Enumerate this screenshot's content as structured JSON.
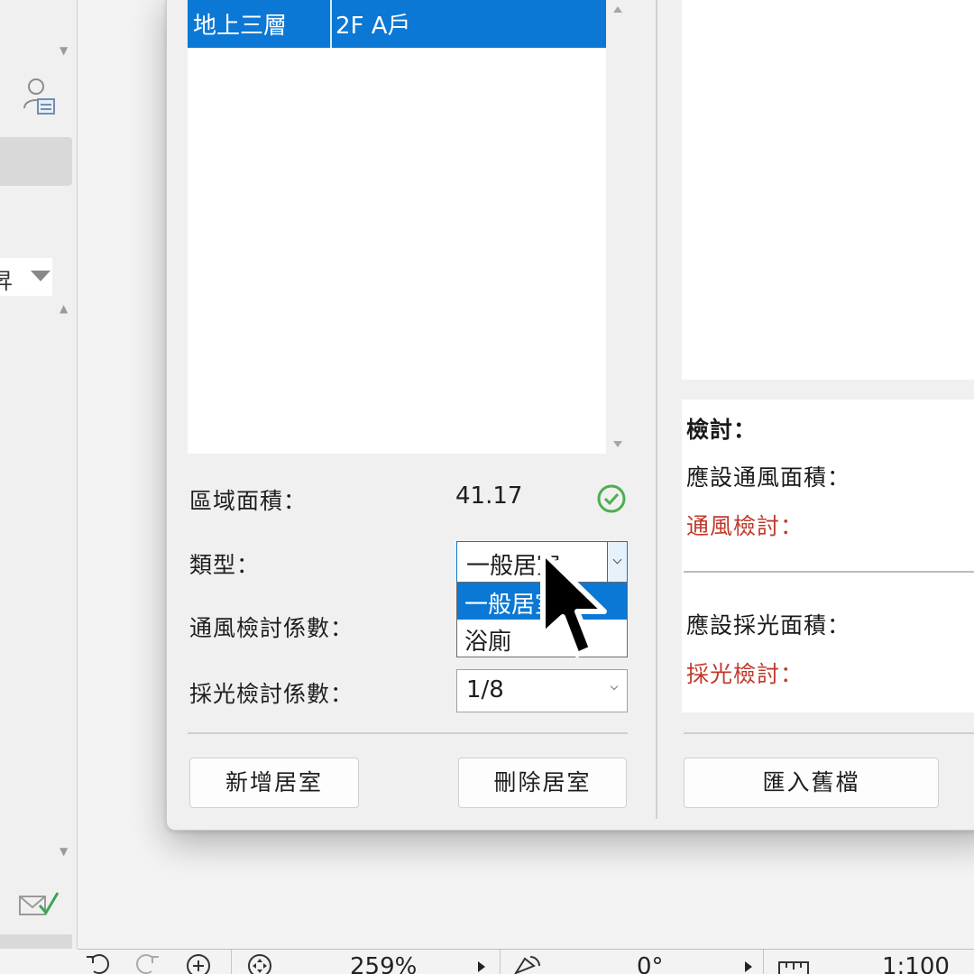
{
  "sidebar": {
    "dropdown_text": "昇"
  },
  "room_table": {
    "rows": [
      {
        "floor": "地上三層",
        "unit": "2F A戶",
        "selected": true
      }
    ]
  },
  "form": {
    "area_label": "區域面積：",
    "area_value": "41.17",
    "type_label": "類型：",
    "type_selected": "一般居室",
    "type_options": [
      "一般居室",
      "浴廁"
    ],
    "vent_factor_label": "通風檢討係數：",
    "light_factor_label": "採光檢討係數：",
    "light_factor_value": "1/8"
  },
  "buttons": {
    "add_room": "新增居室",
    "delete_room": "刪除居室",
    "import_old": "匯入舊檔"
  },
  "review": {
    "title": "檢討：",
    "vent_area_label": "應設通風面積：",
    "vent_check_label": "通風檢討：",
    "light_area_label": "應設採光面積：",
    "light_check_label": "採光檢討："
  },
  "status_bar": {
    "zoom": "259%",
    "angle": "0°",
    "scale": "1:100"
  },
  "colors": {
    "accent": "#0a78d4",
    "ok": "#4caf50",
    "warning_text": "#c0392b"
  }
}
